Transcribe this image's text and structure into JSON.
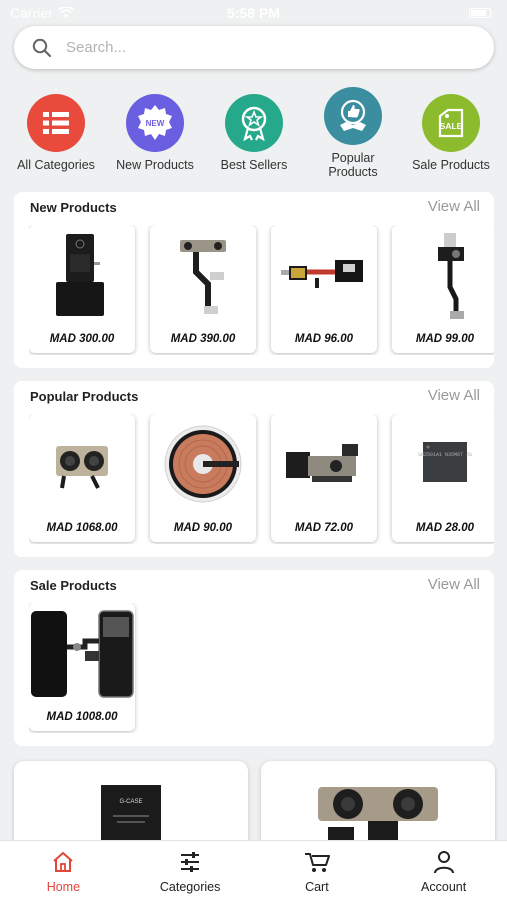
{
  "status_bar": {
    "carrier": "Carrier",
    "time": "5:58 PM"
  },
  "search": {
    "placeholder": "Search..."
  },
  "categories": [
    {
      "label": "All Categories",
      "color": "#e84a3c",
      "icon": "list-icon"
    },
    {
      "label": "New Products",
      "color": "#6a5fe0",
      "icon": "new-badge-icon",
      "badge": "NEW"
    },
    {
      "label": "Best Sellers",
      "color": "#26a98a",
      "icon": "award-star-icon"
    },
    {
      "label": "Popular Products",
      "color": "#3a8ea0",
      "icon": "thumbs-up-ribbon-icon"
    },
    {
      "label": "Sale Products",
      "color": "#8cbc2e",
      "icon": "sale-tag-icon",
      "badge": "SALE"
    }
  ],
  "sections": {
    "new_products": {
      "title": "New Products",
      "view_all": "View All",
      "items": [
        {
          "price": "MAD 300.00",
          "image": "battery"
        },
        {
          "price": "MAD 390.00",
          "image": "front-camera-flex"
        },
        {
          "price": "MAD 96.00",
          "image": "flex-board"
        },
        {
          "price": "MAD 99.00",
          "image": "sensor-flex"
        }
      ]
    },
    "popular_products": {
      "title": "Popular Products",
      "view_all": "View All",
      "items": [
        {
          "price": "MAD 1068.00",
          "image": "rear-camera"
        },
        {
          "price": "MAD 90.00",
          "image": "wireless-coil"
        },
        {
          "price": "MAD 72.00",
          "image": "earpiece-flex"
        },
        {
          "price": "MAD 28.00",
          "image": "ic-chip",
          "chip_text": "SN2501A1 N35M07 JS"
        }
      ]
    },
    "sale_products": {
      "title": "Sale Products",
      "view_all": "View All",
      "items": [
        {
          "price": "MAD 1008.00",
          "image": "lcd-screen"
        }
      ]
    }
  },
  "featured": [
    {
      "image": "battery-box",
      "box_text": "G-CASE"
    },
    {
      "image": "rear-camera-large"
    }
  ],
  "tabbar": [
    {
      "label": "Home",
      "icon": "home-icon",
      "active": true
    },
    {
      "label": "Categories",
      "icon": "sliders-icon",
      "active": false
    },
    {
      "label": "Cart",
      "icon": "cart-icon",
      "active": false
    },
    {
      "label": "Account",
      "icon": "user-icon",
      "active": false
    }
  ],
  "colors": {
    "accent": "#e2463b",
    "background": "#eef0f1"
  }
}
